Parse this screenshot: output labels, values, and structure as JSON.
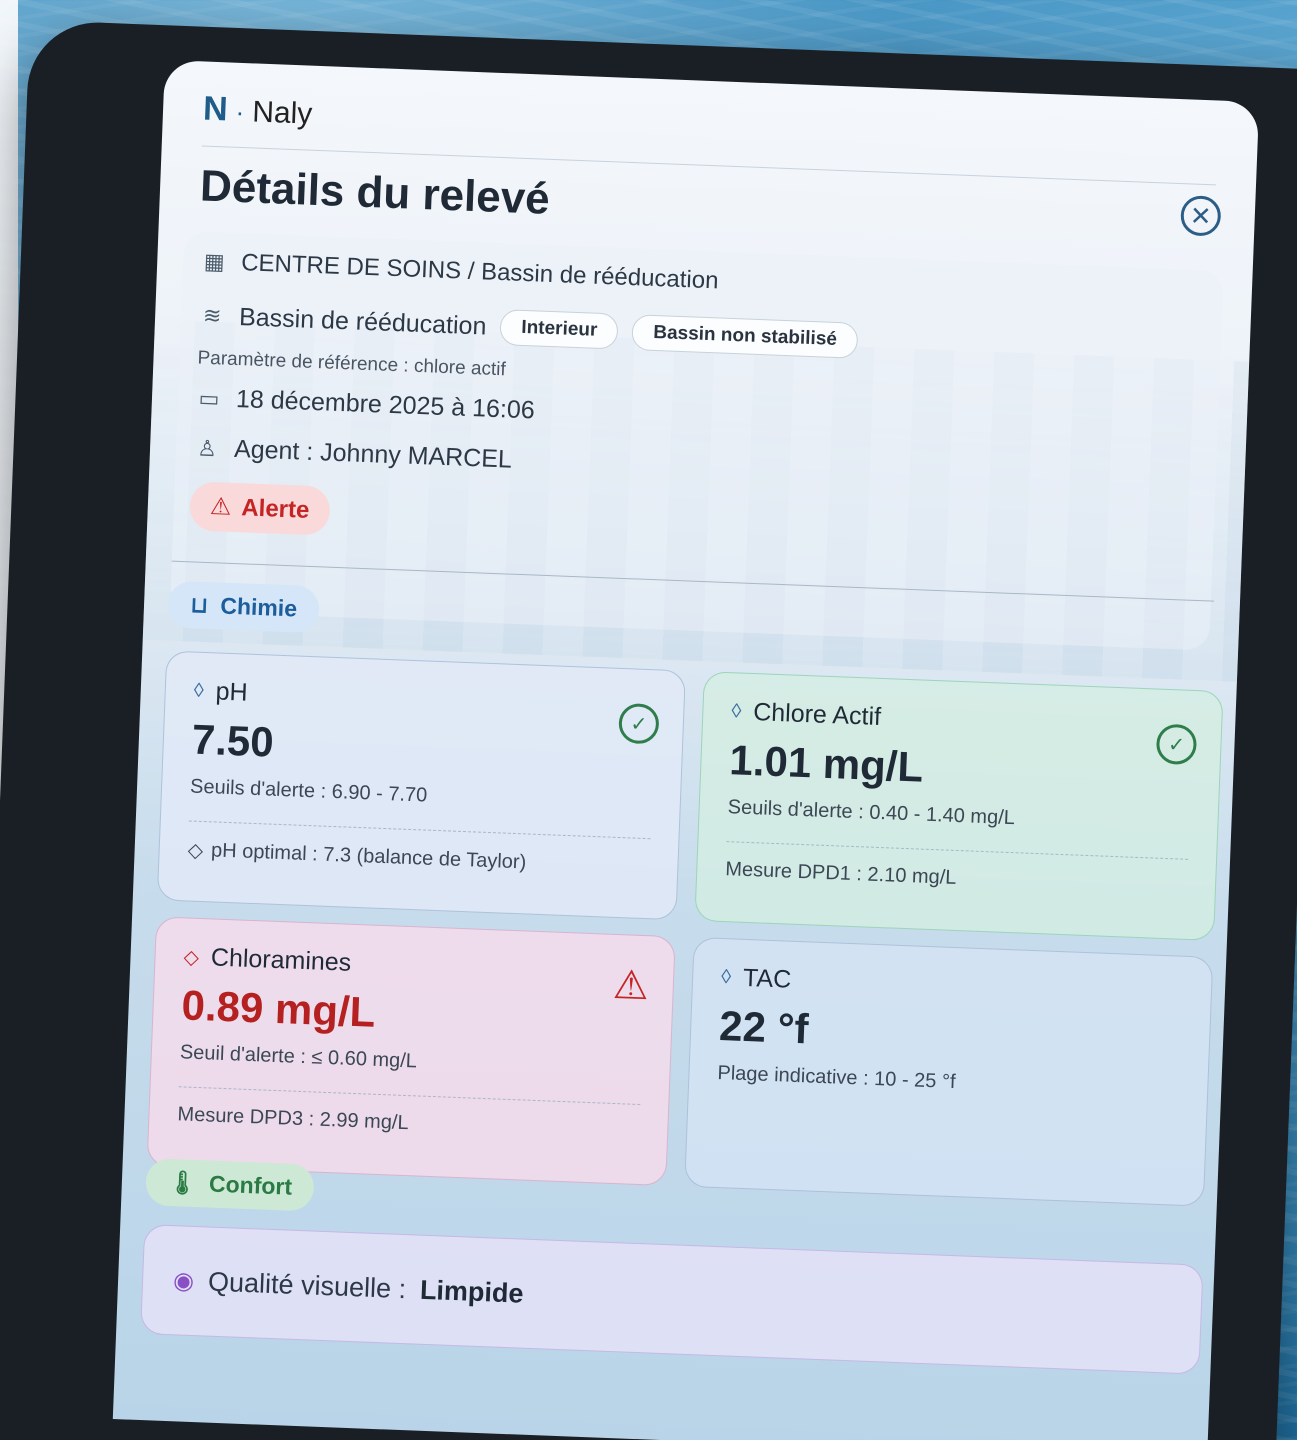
{
  "brand": {
    "letter": "N",
    "separator": "·",
    "name": "Naly"
  },
  "header": {
    "title": "Détails du relevé",
    "close_icon": "✕"
  },
  "info": {
    "site": "CENTRE DE SOINS / Bassin de rééducation",
    "pool": "Bassin de rééducation",
    "tags": [
      "Interieur",
      "Bassin non stabilisé"
    ],
    "reference": "Paramètre de référence : chlore actif",
    "date": "18 décembre 2025 à 16:06",
    "agent": "Agent : Johnny MARCEL",
    "status": "Alerte"
  },
  "sections": {
    "chemistry": "Chimie",
    "comfort": "Confort"
  },
  "metrics": [
    {
      "label": "pH",
      "value": "7.50",
      "threshold": "Seuils d'alerte : 6.90 - 7.70",
      "footer": "pH optimal : 7.3 (balance de Taylor)",
      "state": "ok"
    },
    {
      "label": "Chlore Actif",
      "value": "1.01 mg/L",
      "threshold": "Seuils d'alerte : 0.40 - 1.40 mg/L",
      "footer": "Mesure DPD1 : 2.10 mg/L",
      "state": "ok"
    },
    {
      "label": "Chloramines",
      "value": "0.89 mg/L",
      "threshold": "Seuil d'alerte : ≤ 0.60 mg/L",
      "footer": "Mesure DPD3 : 2.99 mg/L",
      "state": "alert"
    },
    {
      "label": "TAC",
      "value": "22 °f",
      "threshold": "Plage indicative : 10 - 25 °f",
      "footer": "",
      "state": "neutral"
    }
  ],
  "visual_quality": {
    "label": "Qualité visuelle :",
    "value": "Limpide"
  },
  "icons": {
    "building": "building-icon",
    "waves": "waves-icon",
    "calendar": "calendar-icon",
    "user": "user-icon",
    "warning": "warning-icon",
    "flask": "flask-icon",
    "drops": "drops-icon",
    "drop": "drop-icon",
    "thermometer": "thermometer-icon",
    "eye": "eye-icon",
    "check": "check-circle-icon"
  },
  "colors": {
    "alert": "#c42424",
    "ok": "#2f7d4a",
    "brand": "#1f5c8a"
  }
}
